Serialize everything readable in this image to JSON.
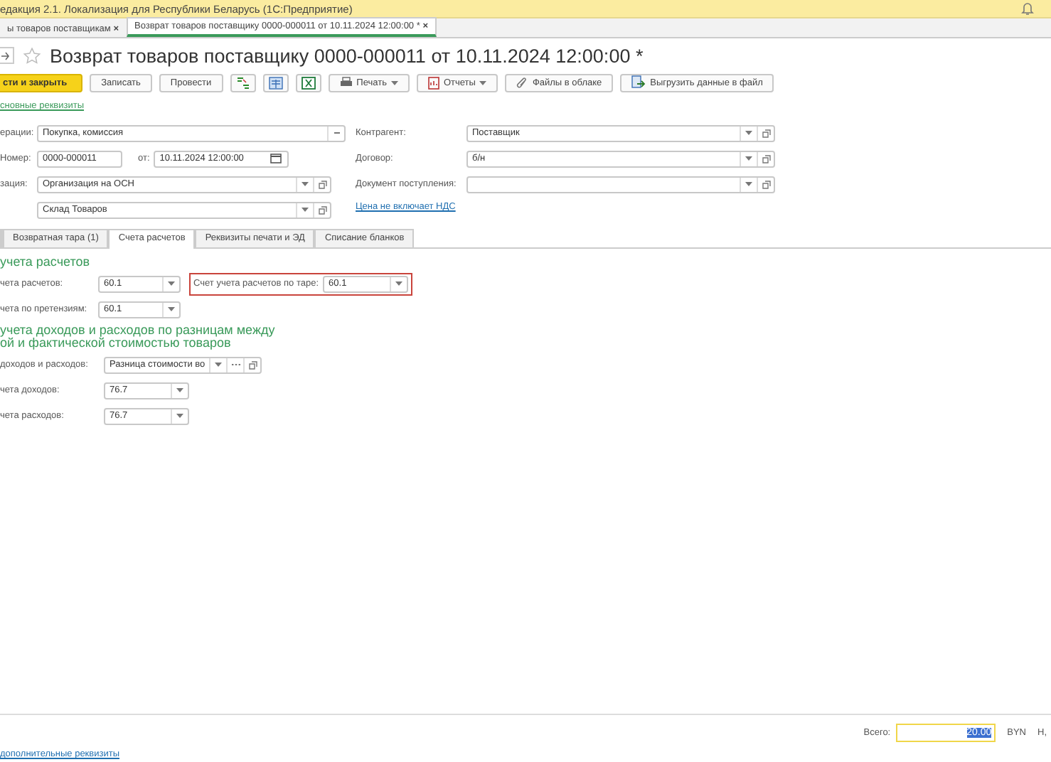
{
  "app_title": "едакция 2.1. Локализация для Республики Беларусь  (1С:Предприятие)",
  "open_tabs": [
    {
      "label": "ы товаров поставщикам",
      "close": "×",
      "selected": false
    },
    {
      "label": "Возврат товаров поставщику 0000-000011 от 10.11.2024 12:00:00 *",
      "close": "×",
      "selected": true
    }
  ],
  "document": {
    "title": "Возврат товаров поставщику 0000-000011 от 10.11.2024 12:00:00 *",
    "favorite": false
  },
  "toolbar": [
    {
      "kind": "primary",
      "label": "сти и закрыть"
    },
    {
      "kind": "text",
      "label": "Записать"
    },
    {
      "kind": "text",
      "label": "Провести"
    },
    {
      "kind": "icon"
    },
    {
      "kind": "icon"
    },
    {
      "kind": "icon"
    },
    {
      "kind": "menu",
      "label": "Печать"
    },
    {
      "kind": "menu",
      "label": "Отчеты"
    },
    {
      "kind": "text",
      "label": "Файлы в облаке"
    },
    {
      "kind": "text",
      "label": "Выгрузить данные в файл"
    }
  ],
  "main_link": "сновные реквизиты",
  "left_fields": {
    "operation": {
      "label": "ерации:",
      "value": "Покупка, комиссия"
    },
    "number": {
      "label": "Номер:",
      "value": "0000-000011"
    },
    "date": {
      "label": "от:",
      "value": "10.11.2024 12:00:00"
    },
    "organization": {
      "label": "зация:",
      "value": "Организация на ОСН"
    },
    "warehouse": {
      "value": "Склад Товаров"
    }
  },
  "right_fields": [
    {
      "label": "Контрагент:",
      "value": "Поставщик"
    },
    {
      "label": "Договор:",
      "value": "б/н"
    },
    {
      "label": "Документ поступления:"
    }
  ],
  "vat_link": "Цена не включает НДС",
  "form_tabs": [
    {
      "label": "Возвратная тара (1)",
      "selected": false
    },
    {
      "label": "Счета расчетов",
      "selected": true
    },
    {
      "label": "Реквизиты печати и ЭД",
      "selected": false
    },
    {
      "label": "Списание бланков",
      "selected": false
    }
  ],
  "section1": {
    "heading": "учета расчетов",
    "rows": [
      {
        "label": "чета расчетов:",
        "value": "60.1"
      },
      {
        "label": "чета  по претензиям:",
        "value": "60.1"
      }
    ],
    "highlighted": {
      "label": "Счет учета расчетов по таре:",
      "value": "60.1"
    }
  },
  "section2": {
    "heading_lines": [
      "учета доходов и расходов по разницам между",
      "ой и фактической стоимостью товаров"
    ],
    "item": {
      "label": "доходов и расходов:",
      "value": "Разница стоимости во"
    },
    "rows": [
      {
        "label": "чета доходов:",
        "value": "76.7"
      },
      {
        "label": "чета расходов:",
        "value": "76.7"
      }
    ]
  },
  "footer": {
    "total_label": "Всего:",
    "total": "20.00",
    "currency": "BYN",
    "cut_label": "Н,",
    "link": "дополнительные реквизиты"
  }
}
